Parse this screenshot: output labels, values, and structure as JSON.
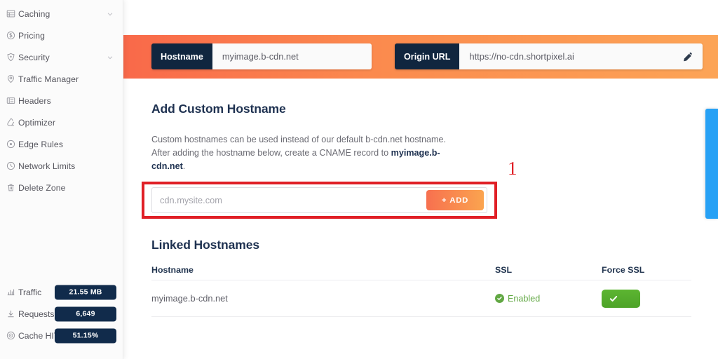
{
  "sidebar": {
    "nav_items": [
      {
        "label": "Caching",
        "icon": "caching-icon",
        "chevron": true
      },
      {
        "label": "Pricing",
        "icon": "pricing-icon",
        "chevron": false
      },
      {
        "label": "Security",
        "icon": "security-shield-icon",
        "chevron": true
      },
      {
        "label": "Traffic Manager",
        "icon": "location-pin-icon",
        "chevron": false
      },
      {
        "label": "Headers",
        "icon": "headers-icon",
        "chevron": false
      },
      {
        "label": "Optimizer",
        "icon": "optimizer-icon",
        "chevron": false
      },
      {
        "label": "Edge Rules",
        "icon": "edge-rules-icon",
        "chevron": false
      },
      {
        "label": "Network Limits",
        "icon": "network-limits-icon",
        "chevron": false
      },
      {
        "label": "Delete Zone",
        "icon": "trash-icon",
        "chevron": false
      }
    ],
    "stats": [
      {
        "label": "Traffic",
        "value": "21.55 MB",
        "icon": "bar-chart-icon"
      },
      {
        "label": "Requests",
        "value": "6,649",
        "icon": "download-icon"
      },
      {
        "label": "Cache HIT",
        "value": "51.15%",
        "icon": "target-icon"
      }
    ]
  },
  "topbar": {
    "hostname_tag": "Hostname",
    "hostname_value": "myimage.b-cdn.net",
    "origin_tag": "Origin URL",
    "origin_value": "https://no-cdn.shortpixel.ai",
    "edit_icon": "pencil-icon"
  },
  "add_hostname": {
    "title": "Add Custom Hostname",
    "desc_part1": "Custom hostnames can be used instead of our default b-cdn.net hostname. After adding the hostname below, create a CNAME record to ",
    "desc_bold": "myimage.b-cdn.net",
    "desc_part2": ".",
    "input_placeholder": "cdn.mysite.com",
    "input_value": "",
    "add_button_label": "ADD",
    "add_button_plus": "+",
    "annotation_number": "1"
  },
  "linked_hostnames": {
    "title": "Linked Hostnames",
    "columns": [
      "Hostname",
      "SSL",
      "Force SSL"
    ],
    "rows": [
      {
        "hostname": "myimage.b-cdn.net",
        "ssl": "Enabled",
        "force_ssl_on": true
      }
    ]
  },
  "right_tab": {
    "name": "feedback-tab"
  },
  "colors": {
    "brand_orange_start": "#f9694a",
    "brand_orange_end": "#fca456",
    "navy": "#10263f",
    "accent_green": "#5cb531",
    "highlight_red": "#e01f26",
    "blue_tab": "#27a1f5"
  }
}
